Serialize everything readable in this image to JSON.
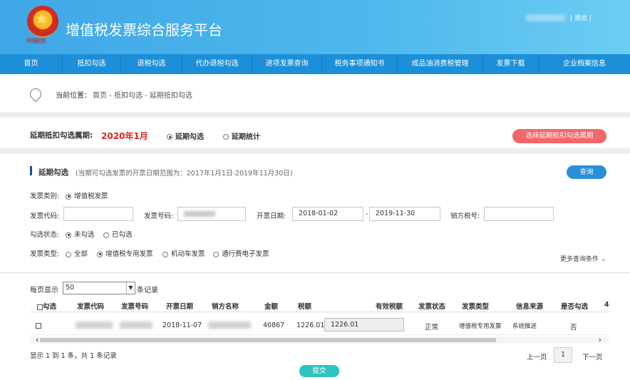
{
  "header": {
    "title": "增值税发票综合服务平台",
    "emblem_text": "中国税务",
    "logout": "| 退出 |"
  },
  "nav": {
    "items": [
      "首页",
      "抵扣勾选",
      "退税勾选",
      "代办退税勾选",
      "进项发票查询",
      "税务事项通知书",
      "成品油消费税管理",
      "发票下载",
      "企业档案信息"
    ]
  },
  "breadcrumb": {
    "label": "当前位置：",
    "path": "首页 - 抵扣勾选 - 延期抵扣勾选"
  },
  "period": {
    "label": "延期抵扣勾选属期:",
    "value": "2020年1月",
    "option_select": "延期勾选",
    "option_stats": "延期统计",
    "select_period_button": "选择延期抵扣勾选属期"
  },
  "section": {
    "title": "延期勾选",
    "note": "(当期可勾选发票的开票日期范围为：2017年1月1日-2019年11月30日)",
    "query_button": "查询"
  },
  "filters": {
    "invoice_category_label": "发票类别:",
    "invoice_category_value": "增值税发票",
    "invoice_code_label": "发票代码:",
    "invoice_code_value": "",
    "invoice_number_label": "发票号码:",
    "issue_date_label": "开票日期:",
    "date_from": "2018-01-02",
    "date_sep": "-",
    "date_to": "2019-11-30",
    "seller_tax_label": "销方税号:",
    "seller_tax_value": "",
    "check_status_label": "勾选状态:",
    "check_status_unchecked": "未勾选",
    "check_status_checked": "已勾选",
    "invoice_type_label": "发票类型:",
    "type_all": "全部",
    "type_special": "增值税专用发票",
    "type_vehicle": "机动车发票",
    "type_toll": "通行费电子发票",
    "more_conditions": "更多查询条件"
  },
  "table": {
    "per_page_label": "每页显示",
    "per_page_value": "50",
    "per_page_suffix": "条记录",
    "columns": [
      "勾选",
      "发票代码",
      "发票号码",
      "开票日期",
      "销方名称",
      "金额",
      "税额",
      "有效税额",
      "发票状态",
      "发票类型",
      "信息来源",
      "是否勾选",
      "4"
    ],
    "row": {
      "issue_date": "2018-11-07",
      "amount": "40867",
      "tax": "1226.01",
      "effective_tax": "1226.01",
      "status": "正常",
      "type": "增值税专用发票",
      "source": "系统推送",
      "checked": "否"
    },
    "summary": "显示 1 到 1 条，共 1 条记录",
    "prev": "上一页",
    "current_page": "1",
    "next": "下一页"
  },
  "submit_button": "提交",
  "colors": {
    "header": "#3fa7e6",
    "nav": "#1c8fd8",
    "red_button": "#f26868",
    "blue_button": "#2b8fd6",
    "submit": "#2fc3c0",
    "period_value": "#e02020"
  }
}
